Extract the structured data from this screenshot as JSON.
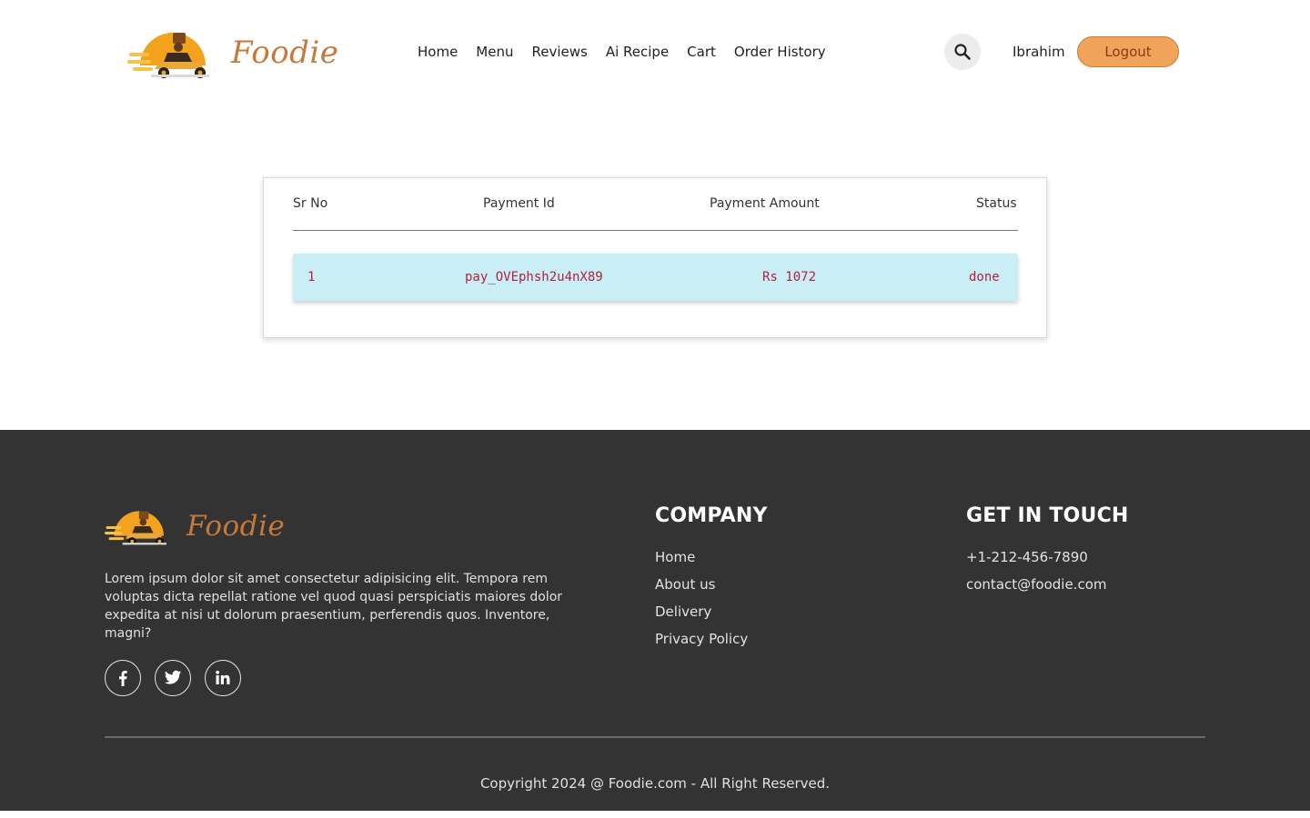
{
  "header": {
    "brand": "Foodie",
    "nav": [
      "Home",
      "Menu",
      "Reviews",
      "Ai Recipe",
      "Cart",
      "Order History"
    ],
    "search_icon": "search-icon",
    "username": "Ibrahim",
    "logout_label": "Logout"
  },
  "table": {
    "headers": {
      "sr_no": "Sr No",
      "payment_id": "Payment Id",
      "payment_amount": "Payment Amount",
      "status": "Status"
    },
    "rows": [
      {
        "sr_no": "1",
        "payment_id": "pay_OVEphsh2u4nX89",
        "amount": "Rs 1072",
        "status": "done"
      }
    ]
  },
  "footer": {
    "brand": "Foodie",
    "description": "Lorem ipsum dolor sit amet consectetur adipisicing elit. Tempora rem voluptas dicta repellat ratione vel quod quasi perspiciatis maiores dolor expedita at nisi ut dolorum praesentium, perferendis quos. Inventore, magni?",
    "socials": [
      "facebook-icon",
      "twitter-icon",
      "linkedin-icon"
    ],
    "company": {
      "title": "COMPANY",
      "links": [
        "Home",
        "About us",
        "Delivery",
        "Privacy Policy"
      ]
    },
    "contact": {
      "title": "GET IN TOUCH",
      "phone": "+1-212-456-7890",
      "email": "contact@foodie.com"
    },
    "copyright": "Copyright 2024 @ Foodie.com - All Right Reserved."
  },
  "colors": {
    "accent": "#f0a35b",
    "brand_text": "#c8793a",
    "row_highlight": "#c9eef6",
    "row_text": "#b1223f",
    "footer_bg": "#333333"
  }
}
